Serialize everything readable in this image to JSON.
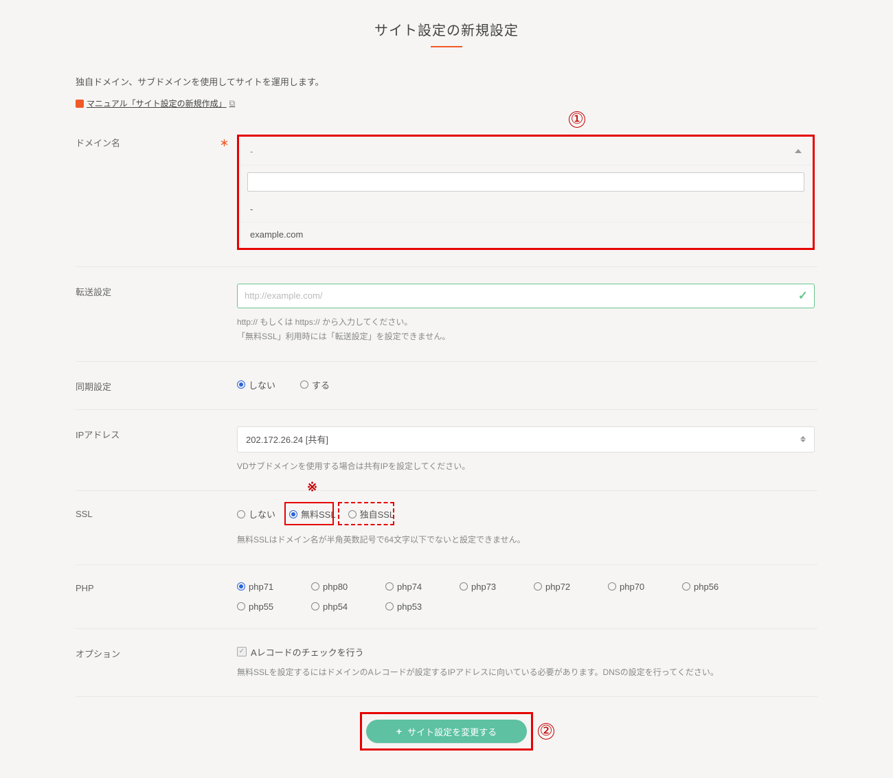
{
  "page": {
    "title": "サイト設定の新規設定",
    "intro": "独自ドメイン、サブドメインを使用してサイトを運用します。",
    "manual_link": "マニュアル「サイト設定の新規作成」",
    "annotations": {
      "num1": "①",
      "num2": "②",
      "asterisk": "※"
    }
  },
  "domain": {
    "label": "ドメイン名",
    "selected_display": "-",
    "options": [
      "-",
      "example.com"
    ]
  },
  "transfer": {
    "label": "転送設定",
    "placeholder": "http://example.com/",
    "helper1": "http:// もしくは https:// から入力してください。",
    "helper2": "「無料SSL」利用時には「転送設定」を設定できません。"
  },
  "sync": {
    "label": "同期設定",
    "opt_no": "しない",
    "opt_yes": "する",
    "selected": "no"
  },
  "ip": {
    "label": "IPアドレス",
    "value": "202.172.26.24 [共有]",
    "helper": "VDサブドメインを使用する場合は共有IPを設定してください。"
  },
  "ssl": {
    "label": "SSL",
    "opt_none": "しない",
    "opt_free": "無料SSL",
    "opt_own": "独自SSL",
    "selected": "free",
    "helper": "無料SSLはドメイン名が半角英数記号で64文字以下でないと設定できません。"
  },
  "php": {
    "label": "PHP",
    "rows": [
      [
        "php71",
        "php80",
        "php74",
        "php73",
        "php72",
        "php70",
        "php56"
      ],
      [
        "php55",
        "php54",
        "php53"
      ]
    ],
    "selected": "php71"
  },
  "option": {
    "label": "オプション",
    "checkbox_label": "Aレコードのチェックを行う",
    "helper": "無料SSLを設定するにはドメインのAレコードが設定するIPアドレスに向いている必要があります。DNSの設定を行ってください。"
  },
  "submit": {
    "label": "サイト設定を変更する"
  }
}
